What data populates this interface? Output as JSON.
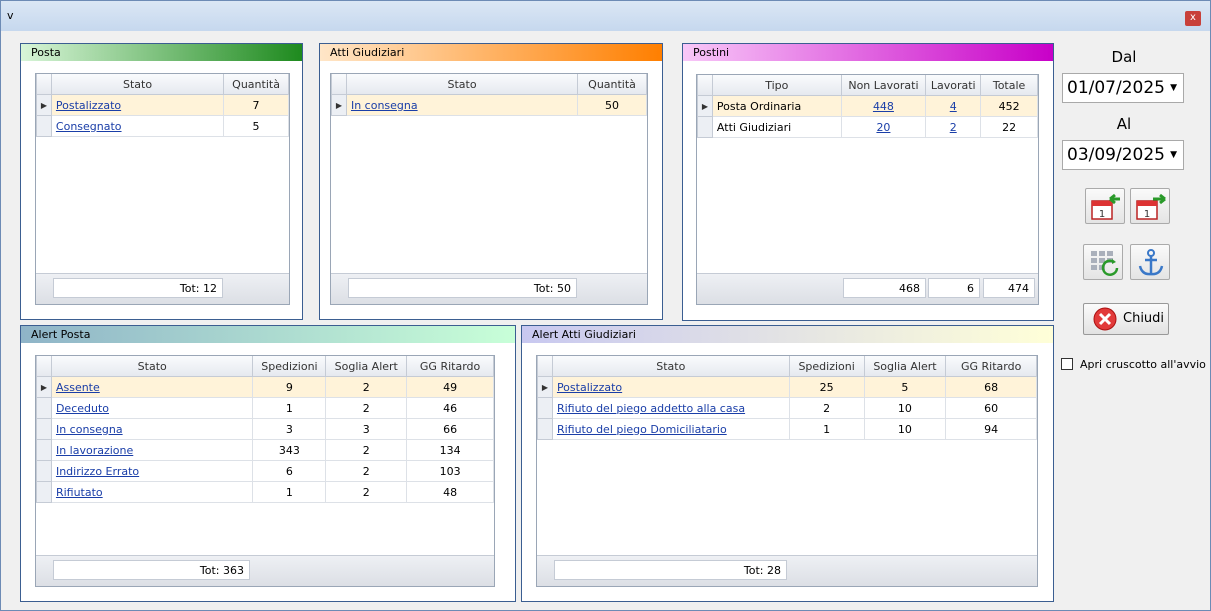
{
  "window": {
    "title": "v",
    "close_label": "x"
  },
  "posta": {
    "title": "Posta",
    "columns": [
      "Stato",
      "Quantità"
    ],
    "rows": [
      {
        "stato": "Postalizzato",
        "quantita": "7"
      },
      {
        "stato": "Consegnato",
        "quantita": "5"
      }
    ],
    "total": "Tot: 12"
  },
  "atti": {
    "title": "Atti Giudiziari",
    "columns": [
      "Stato",
      "Quantità"
    ],
    "rows": [
      {
        "stato": "In consegna",
        "quantita": "50"
      }
    ],
    "total": "Tot: 50"
  },
  "postini": {
    "title": "Postini",
    "columns": [
      "Tipo",
      "Non Lavorati",
      "Lavorati",
      "Totale"
    ],
    "rows": [
      {
        "tipo": "Posta Ordinaria",
        "non_lavorati": "448",
        "lavorati": "4",
        "totale": "452"
      },
      {
        "tipo": "Atti Giudiziari",
        "non_lavorati": "20",
        "lavorati": "2",
        "totale": "22"
      }
    ],
    "totals": {
      "non_lavorati": "468",
      "lavorati": "6",
      "totale": "474"
    }
  },
  "alert_posta": {
    "title": "Alert Posta",
    "columns": [
      "Stato",
      "Spedizioni",
      "Soglia Alert",
      "GG Ritardo"
    ],
    "rows": [
      {
        "stato": "Assente",
        "spedizioni": "9",
        "soglia": "2",
        "ritardo": "49"
      },
      {
        "stato": "Deceduto",
        "spedizioni": "1",
        "soglia": "2",
        "ritardo": "46"
      },
      {
        "stato": "In consegna",
        "spedizioni": "3",
        "soglia": "3",
        "ritardo": "66"
      },
      {
        "stato": "In lavorazione",
        "spedizioni": "343",
        "soglia": "2",
        "ritardo": "134"
      },
      {
        "stato": "Indirizzo Errato",
        "spedizioni": "6",
        "soglia": "2",
        "ritardo": "103"
      },
      {
        "stato": "Rifiutato",
        "spedizioni": "1",
        "soglia": "2",
        "ritardo": "48"
      }
    ],
    "total": "Tot: 363"
  },
  "alert_atti": {
    "title": "Alert Atti Giudiziari",
    "columns": [
      "Stato",
      "Spedizioni",
      "Soglia Alert",
      "GG Ritardo"
    ],
    "rows": [
      {
        "stato": "Postalizzato",
        "spedizioni": "25",
        "soglia": "5",
        "ritardo": "68"
      },
      {
        "stato": "Rifiuto del piego addetto alla casa",
        "spedizioni": "2",
        "soglia": "10",
        "ritardo": "60"
      },
      {
        "stato": "Rifiuto del piego Domiciliatario",
        "spedizioni": "1",
        "soglia": "10",
        "ritardo": "94"
      }
    ],
    "total": "Tot: 28"
  },
  "sidebar": {
    "dal_label": "Dal",
    "dal_value": "01/07/2025",
    "al_label": "Al",
    "al_value": "03/09/2025",
    "close_button": "Chiudi",
    "auto_open_label": "Apri cruscotto all'avvio"
  },
  "colors": {
    "posta_head": "#1e8a1e",
    "atti_head": "#ff7f00",
    "postini_head": "#c800c8",
    "alert_posta_head": "#8fb4c8",
    "alert_atti_head": "#c8c8f0"
  }
}
